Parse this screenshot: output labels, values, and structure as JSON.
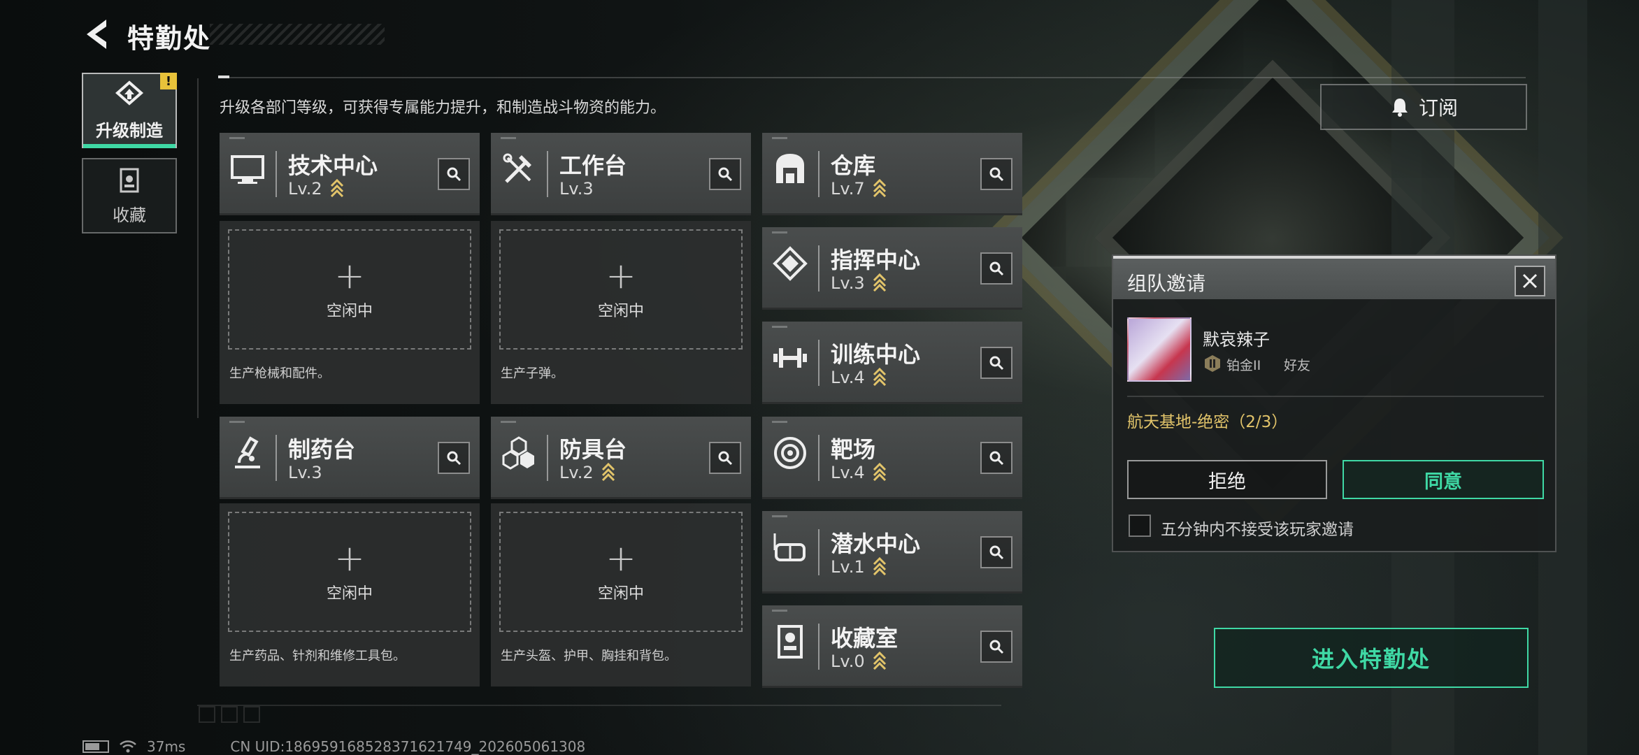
{
  "header": {
    "title": "特勤处"
  },
  "nav": [
    {
      "label": "升级制造",
      "active": true,
      "badge": "!"
    },
    {
      "label": "收藏",
      "active": false
    }
  ],
  "description": "升级各部门等级，可获得专属能力提升，和制造战斗物资的能力。",
  "subscribe_label": "订阅",
  "facilities": [
    {
      "name": "技术中心",
      "level": "Lv.2",
      "upgradable": true,
      "icon": "monitor-icon"
    },
    {
      "name": "工作台",
      "level": "Lv.3",
      "upgradable": false,
      "icon": "tools-icon"
    },
    {
      "name": "仓库",
      "level": "Lv.7",
      "upgradable": true,
      "icon": "warehouse-icon"
    },
    {
      "name": "指挥中心",
      "level": "Lv.3",
      "upgradable": true,
      "icon": "chip-icon"
    },
    {
      "name": "训练中心",
      "level": "Lv.4",
      "upgradable": true,
      "icon": "dumbbell-icon"
    },
    {
      "name": "制药台",
      "level": "Lv.3",
      "upgradable": false,
      "icon": "microscope-icon"
    },
    {
      "name": "防具台",
      "level": "Lv.2",
      "upgradable": true,
      "icon": "armor-icon"
    },
    {
      "name": "靶场",
      "level": "Lv.4",
      "upgradable": true,
      "icon": "target-icon"
    },
    {
      "name": "潜水中心",
      "level": "Lv.1",
      "upgradable": true,
      "icon": "diving-mask-icon"
    },
    {
      "name": "收藏室",
      "level": "Lv.0",
      "upgradable": true,
      "icon": "collection-icon"
    }
  ],
  "production_slots": [
    {
      "status": "空闲中",
      "description": "生产枪械和配件。"
    },
    {
      "status": "空闲中",
      "description": "生产子弹。"
    },
    {
      "status": "空闲中",
      "description": "生产药品、针剂和维修工具包。"
    },
    {
      "status": "空闲中",
      "description": "生产头盔、护甲、胸挂和背包。"
    }
  ],
  "invite": {
    "title": "组队邀请",
    "player_name": "默哀辣子",
    "rank": "铂金II",
    "relation": "好友",
    "mission": "航天基地-绝密（2/3）",
    "refuse_label": "拒绝",
    "accept_label": "同意",
    "mute_label": "五分钟内不接受该玩家邀请"
  },
  "enter_label": "进入特勤处",
  "status_bar": {
    "ping": "37ms",
    "uid": "CN UID:1869591685283716217​49_202605061308"
  },
  "colors": {
    "accent": "#3fd9a5",
    "gold": "#e2c46a",
    "badge": "#e8c23a"
  }
}
